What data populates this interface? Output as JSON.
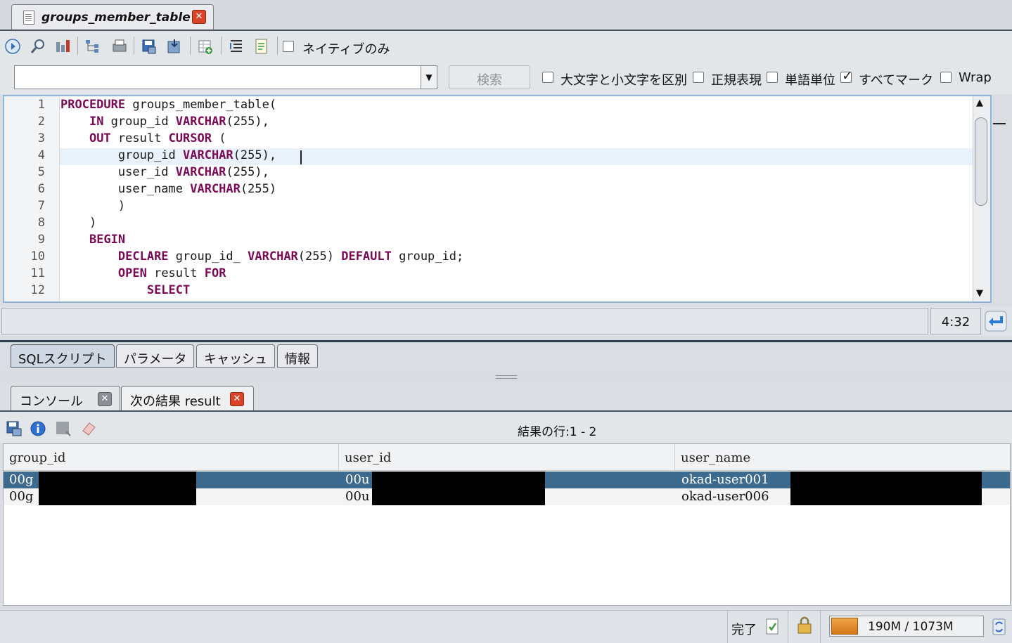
{
  "window": {
    "doc_tab": "groups_member_table"
  },
  "toolbar": {
    "native_only_label": "ネイティブのみ"
  },
  "search": {
    "input_value": "",
    "search_button": "検索",
    "case_sensitive_label": "大文字と小文字を区別",
    "case_sensitive_checked": false,
    "regex_label": "正規表現",
    "regex_checked": false,
    "word_label": "単語単位",
    "word_checked": false,
    "mark_all_label": "すべてマーク",
    "mark_all_checked": true,
    "wrap_label": "Wrap",
    "wrap_checked": false
  },
  "editor": {
    "line_numbers": [
      "1",
      "2",
      "3",
      "4",
      "5",
      "6",
      "7",
      "8",
      "9",
      "10",
      "11",
      "12"
    ],
    "lines": [
      [
        {
          "k": true,
          "t": "PROCEDURE"
        },
        {
          "k": false,
          "t": " groups_member_table("
        }
      ],
      [
        {
          "k": false,
          "t": "    "
        },
        {
          "k": true,
          "t": "IN"
        },
        {
          "k": false,
          "t": " group_id "
        },
        {
          "k": true,
          "t": "VARCHAR"
        },
        {
          "k": false,
          "t": "(255),"
        }
      ],
      [
        {
          "k": false,
          "t": "    "
        },
        {
          "k": true,
          "t": "OUT"
        },
        {
          "k": false,
          "t": " result "
        },
        {
          "k": true,
          "t": "CURSOR"
        },
        {
          "k": false,
          "t": " ("
        }
      ],
      [
        {
          "k": false,
          "t": "        group_id "
        },
        {
          "k": true,
          "t": "VARCHAR"
        },
        {
          "k": false,
          "t": "(255), "
        }
      ],
      [
        {
          "k": false,
          "t": "        user_id "
        },
        {
          "k": true,
          "t": "VARCHAR"
        },
        {
          "k": false,
          "t": "(255),"
        }
      ],
      [
        {
          "k": false,
          "t": "        user_name "
        },
        {
          "k": true,
          "t": "VARCHAR"
        },
        {
          "k": false,
          "t": "(255)"
        }
      ],
      [
        {
          "k": false,
          "t": "        )"
        }
      ],
      [
        {
          "k": false,
          "t": "    )"
        }
      ],
      [
        {
          "k": false,
          "t": "    "
        },
        {
          "k": true,
          "t": "BEGIN"
        }
      ],
      [
        {
          "k": false,
          "t": "        "
        },
        {
          "k": true,
          "t": "DECLARE"
        },
        {
          "k": false,
          "t": " group_id_ "
        },
        {
          "k": true,
          "t": "VARCHAR"
        },
        {
          "k": false,
          "t": "(255) "
        },
        {
          "k": true,
          "t": "DEFAULT"
        },
        {
          "k": false,
          "t": " group_id;"
        }
      ],
      [
        {
          "k": false,
          "t": "        "
        },
        {
          "k": true,
          "t": "OPEN"
        },
        {
          "k": false,
          "t": " result "
        },
        {
          "k": true,
          "t": "FOR"
        }
      ],
      [
        {
          "k": false,
          "t": "            "
        },
        {
          "k": true,
          "t": "SELECT"
        }
      ]
    ],
    "cursor_position": "4:32",
    "colors": {
      "keyword": "#7a0a55",
      "current_line": "#e9f1fb"
    }
  },
  "bottom_tabs": [
    "SQLスクリプト",
    "パラメータ",
    "キャッシュ",
    "情報"
  ],
  "result_tabs": [
    {
      "label": "コンソール"
    },
    {
      "label": "次の結果 result"
    }
  ],
  "results": {
    "row_count_text": "結果の行:1 - 2",
    "columns": [
      "group_id",
      "user_id",
      "user_name"
    ],
    "rows": [
      [
        "00g",
        "00u",
        "okad-user001"
      ],
      [
        "00g",
        "00u",
        "okad-user006"
      ]
    ],
    "selected_row_color": "#3d6a8f"
  },
  "status": {
    "text": "完了",
    "memory": "190M / 1073M",
    "memory_used_fraction": 0.177
  }
}
